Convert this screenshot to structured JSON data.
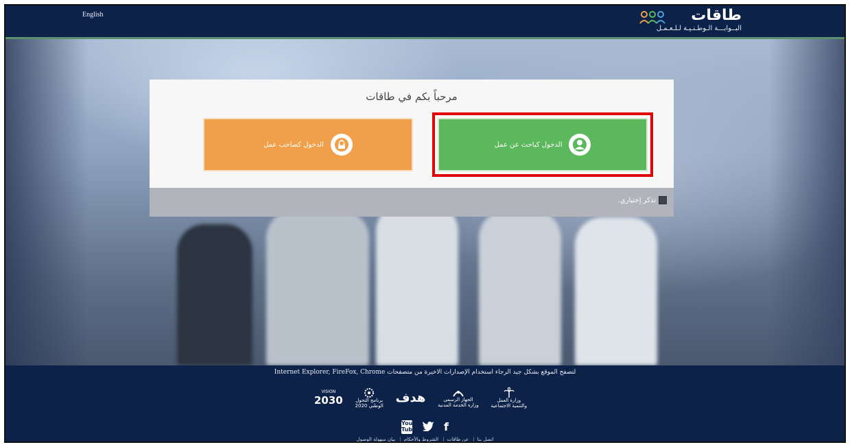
{
  "header": {
    "language_link": "English",
    "logo_title": "طاقات",
    "logo_subtitle": "البــوابـــة الـوطـنـيـة لـلـعـمـل"
  },
  "card": {
    "title": "مرحباً بكم في طاقات",
    "employer_button": "الدخول كصاحب عمل",
    "jobseeker_button": "الدخول كباحث عن عمل",
    "remember_label": "تذكر إختياري."
  },
  "footer": {
    "browser_note": "لتصفح الموقع بشكل جيد الرجاء استخدام الإصدارات الاخيرة من متصفحات Internet Explorer, FireFox, Chrome",
    "partners": [
      {
        "icon": "palm-swords-emblem-icon",
        "line1": "وزارة العمل",
        "line2": "والتنمية الاجتماعية"
      },
      {
        "icon": "civil-service-emblem-icon",
        "line1": "الجهاز الرسمي",
        "line2": "وزارة الخدمة المدنية"
      },
      {
        "icon": "hadaf-logo-icon",
        "line1": "هدف",
        "line2": ""
      },
      {
        "icon": "ntp-emblem-icon",
        "line1": "برنامج التحول",
        "line2": "الوطني 2020"
      },
      {
        "icon": "vision-2030-logo-icon",
        "line1": "2030",
        "line2": "VISION"
      }
    ],
    "social": [
      {
        "icon": "youtube-icon",
        "label": "You Tube"
      },
      {
        "icon": "twitter-icon",
        "label": "🐦"
      },
      {
        "icon": "facebook-icon",
        "label": "f"
      }
    ],
    "links": [
      "اتصل بنا",
      "عن طاقات",
      "الشروط والأحكام",
      "بيان سهولة الوصول"
    ]
  },
  "colors": {
    "navy": "#0d2249",
    "employer_orange": "#f0a04b",
    "seeker_green": "#5cb85c",
    "highlight_red": "#e00000"
  }
}
